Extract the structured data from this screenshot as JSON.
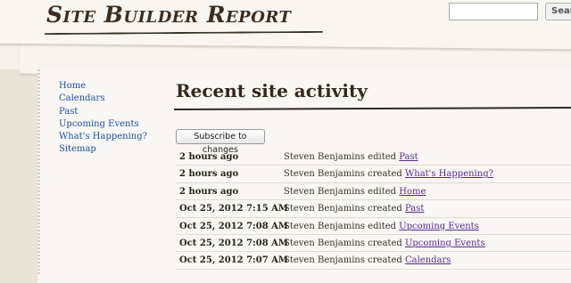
{
  "header": {
    "site_title": "Site Builder Report",
    "search_placeholder": "",
    "search_button_label": "Search"
  },
  "sidebar": {
    "items": [
      {
        "label": "Home"
      },
      {
        "label": "Calendars"
      },
      {
        "label": "Past"
      },
      {
        "label": "Upcoming Events"
      },
      {
        "label": "What's Happening?"
      },
      {
        "label": "Sitemap"
      }
    ]
  },
  "main": {
    "heading": "Recent site activity",
    "subscribe_label": "Subscribe to changes",
    "activity": [
      {
        "time": "2 hours ago",
        "text": "Steven Benjamins edited",
        "link": "Past"
      },
      {
        "time": "2 hours ago",
        "text": "Steven Benjamins created",
        "link": "What's Happening?"
      },
      {
        "time": "2 hours ago",
        "text": "Steven Benjamins edited",
        "link": "Home"
      },
      {
        "time": "Oct 25, 2012 7:15 AM",
        "text": "Steven Benjamins created",
        "link": "Past"
      },
      {
        "time": "Oct 25, 2012 7:08 AM",
        "text": "Steven Benjamins edited",
        "link": "Upcoming Events"
      },
      {
        "time": "Oct 25, 2012 7:08 AM",
        "text": "Steven Benjamins created",
        "link": "Upcoming Events"
      },
      {
        "time": "Oct 25, 2012 7:07 AM",
        "text": "Steven Benjamins created",
        "link": "Calendars"
      }
    ]
  },
  "colors": {
    "link": "#1f4ea1",
    "visited_link": "#5a2a91",
    "heading": "#372817",
    "paper": "#f8f7f3"
  }
}
